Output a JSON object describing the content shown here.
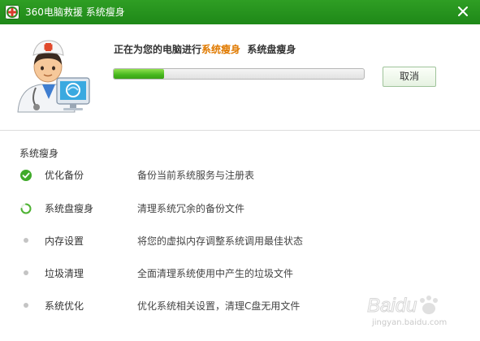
{
  "window": {
    "title": "360电脑救援  系统瘦身"
  },
  "header": {
    "status_prefix": "正在为您的电脑进行",
    "status_highlight": "系统瘦身",
    "status_current": "系统盘瘦身",
    "progress_percent": 20,
    "cancel_label": "取消"
  },
  "tasks": {
    "section_title": "系统瘦身",
    "items": [
      {
        "name": "优化备份",
        "desc": "备份当前系统服务与注册表",
        "state": "done"
      },
      {
        "name": "系统盘瘦身",
        "desc": "清理系统冗余的备份文件",
        "state": "running"
      },
      {
        "name": "内存设置",
        "desc": "将您的虚拟内存调整系统调用最佳状态",
        "state": "pending"
      },
      {
        "name": "垃圾清理",
        "desc": "全面清理系统使用中产生的垃圾文件",
        "state": "pending"
      },
      {
        "name": "系统优化",
        "desc": "优化系统相关设置，清理C盘无用文件",
        "state": "pending"
      }
    ]
  },
  "watermark": {
    "brand": "Baidu",
    "sub": "jingyan.baidu.com"
  },
  "colors": {
    "titlebar": "#1e8818",
    "accent": "#e07a00",
    "progress": "#46b71d"
  }
}
